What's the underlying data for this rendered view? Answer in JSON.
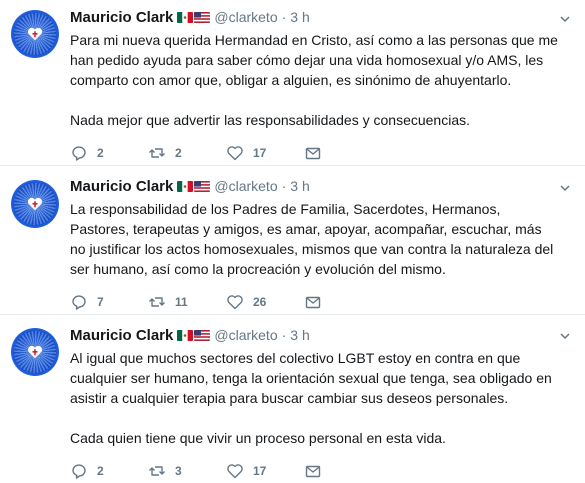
{
  "tweets": [
    {
      "author_name": "Mauricio Clark",
      "handle": "@clarketo",
      "separator": "·",
      "time": "3 h",
      "paragraphs": [
        "Para mi nueva querida Hermandad en Cristo, así como a las personas que me han pedido ayuda para saber cómo dejar una vida homosexual y/o AMS, les comparto con amor que, obligar a alguien, es sinónimo de ahuyentarlo.",
        "Nada mejor que advertir las responsabilidades y consecuencias."
      ],
      "replies": "2",
      "retweets": "2",
      "likes": "17"
    },
    {
      "author_name": "Mauricio Clark",
      "handle": "@clarketo",
      "separator": "·",
      "time": "3 h",
      "paragraphs": [
        "La responsabilidad de los Padres de Familia, Sacerdotes, Hermanos, Pastores, terapeutas y amigos, es amar, apoyar, acompañar, escuchar, más no justificar los actos homosexuales, mismos que van contra la naturaleza del ser humano, así como la procreación y evolución del mismo."
      ],
      "replies": "7",
      "retweets": "11",
      "likes": "26"
    },
    {
      "author_name": "Mauricio Clark",
      "handle": "@clarketo",
      "separator": "·",
      "time": "3 h",
      "paragraphs": [
        "Al igual que muchos sectores del colectivo LGBT estoy en contra en que cualquier ser humano, tenga la orientación sexual que tenga, sea obligado en asistir a cualquier terapia para buscar cambiar sus deseos personales.",
        "Cada quien tiene que vivir un proceso personal en esta vida."
      ],
      "replies": "2",
      "retweets": "3",
      "likes": "17"
    }
  ],
  "icons": {
    "reply": "reply-icon",
    "retweet": "retweet-icon",
    "like": "heart-icon",
    "message": "envelope-icon",
    "caret": "chevron-down-icon",
    "flags": [
      "mexico-flag-icon",
      "usa-flag-icon"
    ]
  },
  "colors": {
    "text": "#14171a",
    "secondary": "#657786",
    "divider": "#e6ecf0",
    "avatar_blue": "#1a56d6"
  }
}
